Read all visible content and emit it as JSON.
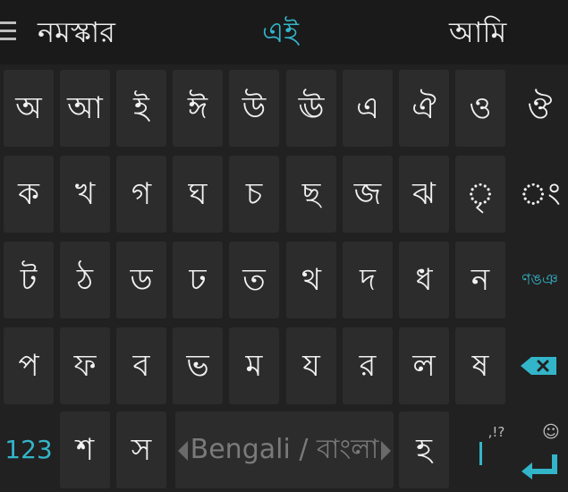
{
  "suggestions": {
    "menu_icon": "hamburger-menu-icon",
    "left": "নমস্কার",
    "middle": "এই",
    "right": "আমি",
    "accent_color": "#33b5c9"
  },
  "keyboard": {
    "row1": [
      "অ",
      "আ",
      "ই",
      "ঈ",
      "উ",
      "ঊ",
      "এ",
      "ঐ",
      "ও",
      "ঔ"
    ],
    "row2": [
      "ক",
      "খ",
      "গ",
      "ঘ",
      "চ",
      "ছ",
      "জ",
      "ঝ",
      "ৃ",
      "ং"
    ],
    "row3": [
      "ট",
      "ঠ",
      "ড",
      "ঢ",
      "ত",
      "থ",
      "দ",
      "ধ",
      "ন",
      "ণঙঞ"
    ],
    "row4": [
      "প",
      "ফ",
      "ব",
      "ভ",
      "ম",
      "য",
      "র",
      "ল",
      "ষ"
    ],
    "row4_action_icon": "backspace-icon",
    "row5": {
      "numbers_key": "123",
      "key_sha": "শ",
      "key_sa": "স",
      "space_label": "Bengali / বাংলা",
      "key_ha": "হ",
      "punct_hint": ",!?",
      "emoji_hint": "☺",
      "enter_icon": "enter-icon"
    }
  }
}
